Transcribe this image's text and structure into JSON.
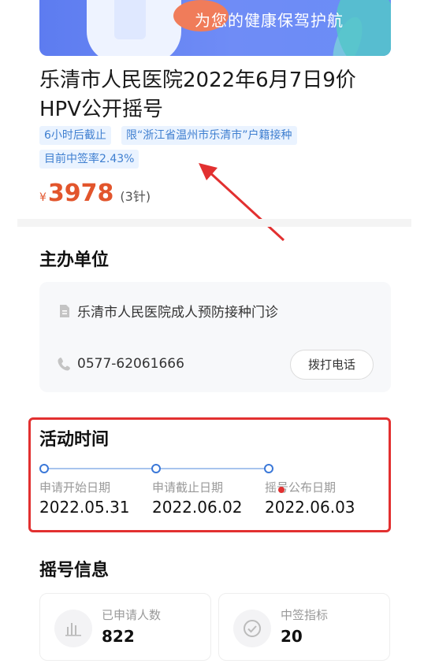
{
  "banner": {
    "slogan": "为您的健康保驾护航"
  },
  "event": {
    "title": "乐清市人民医院2022年6月7日9价HPV公开摇号",
    "tags": [
      "6小时后截止",
      "限“浙江省温州市乐清市”户籍接种",
      "目前中签率2.43%"
    ],
    "price": {
      "currency": "¥",
      "amount": "3978",
      "unit": "(3针)"
    }
  },
  "organizer": {
    "section_title": "主办单位",
    "name": "乐清市人民医院成人预防接种门诊",
    "phone": "0577-62061666",
    "call_label": "拨打电话"
  },
  "schedule": {
    "section_title": "活动时间",
    "items": [
      {
        "label": "申请开始日期",
        "date": "2022.05.31"
      },
      {
        "label": "申请截止日期",
        "date": "2022.06.02"
      },
      {
        "label": "摇号公布日期",
        "date": "2022.06.03"
      }
    ]
  },
  "lottery": {
    "section_title": "摇号信息",
    "stats": [
      {
        "label": "已申请人数",
        "value": "822",
        "icon": "bar-chart-icon"
      },
      {
        "label": "中签指标",
        "value": "20",
        "icon": "check-circle-icon"
      }
    ]
  },
  "colors": {
    "accent": "#3b78d8",
    "price": "#e2552c",
    "highlight": "#e23030"
  }
}
